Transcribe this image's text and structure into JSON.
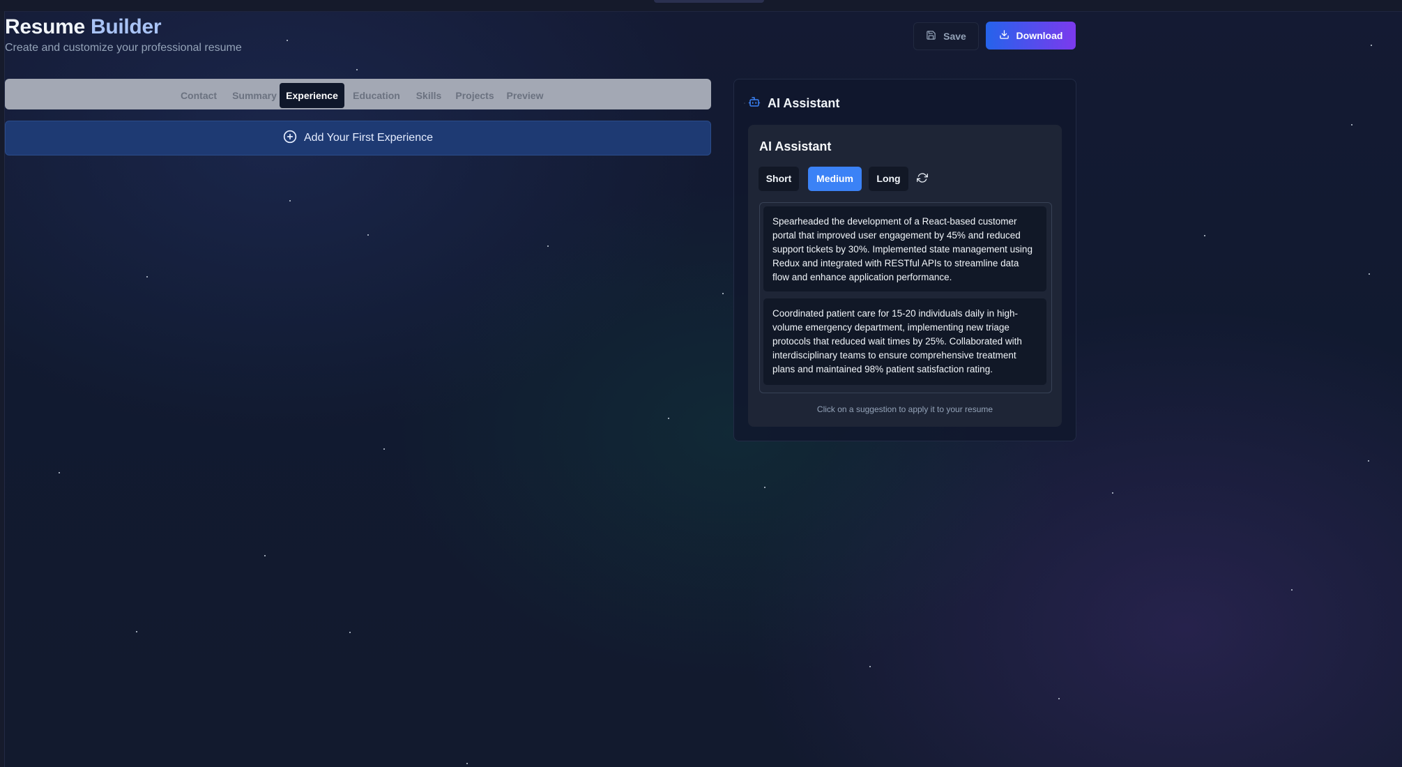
{
  "header": {
    "title_main": "Resume",
    "title_accent": "Builder",
    "subtitle": "Create and customize your professional resume"
  },
  "actions": {
    "save_label": "Save",
    "download_label": "Download"
  },
  "tabs": [
    {
      "label": "Contact",
      "active": false
    },
    {
      "label": "Summary",
      "active": false
    },
    {
      "label": "Experience",
      "active": true
    },
    {
      "label": "Education",
      "active": false
    },
    {
      "label": "Skills",
      "active": false
    },
    {
      "label": "Projects",
      "active": false
    },
    {
      "label": "Preview",
      "active": false
    }
  ],
  "experience": {
    "add_first_label": "Add Your First Experience"
  },
  "ai_panel": {
    "title": "AI Assistant",
    "card_title": "AI Assistant",
    "length_options": [
      {
        "label": "Short",
        "active": false
      },
      {
        "label": "Medium",
        "active": true
      },
      {
        "label": "Long",
        "active": false
      }
    ],
    "suggestions": [
      "Spearheaded the development of a React-based customer portal that improved user engagement by 45% and reduced support tickets by 30%. Implemented state management using Redux and integrated with RESTful APIs to streamline data flow and enhance application performance.",
      "Coordinated patient care for 15-20 individuals daily in high-volume emergency department, implementing new triage protocols that reduced wait times by 25%. Collaborated with interdisciplinary teams to ensure comprehensive treatment plans and maintained 98% patient satisfaction rating."
    ],
    "hint": "Click on a suggestion to apply it to your resume"
  },
  "icons": {
    "save": "floppy-disk-icon",
    "download": "download-icon",
    "add": "plus-circle-icon",
    "assistant": "robot-icon",
    "regenerate": "refresh-icon"
  },
  "colors": {
    "accent_blue": "#3b82f6",
    "download_gradient_start": "#2563eb",
    "download_gradient_end": "#7c3aed"
  }
}
